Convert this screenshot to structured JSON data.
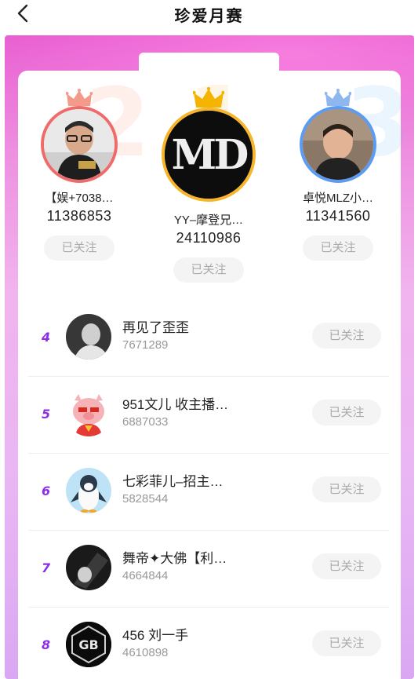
{
  "nav": {
    "title": "珍爱月赛",
    "back_icon": "chevron-left-icon"
  },
  "colors": {
    "rank_accent": "#8d2ee6",
    "header_gradient_top": "#e95fd2",
    "silver_ring": "#f06a6a",
    "gold_ring": "#f7b52c",
    "bronze_ring": "#5b9cf2"
  },
  "podium": [
    {
      "rank_bg": "2",
      "name": "【娱+7038…",
      "score": "11386853",
      "follow_label": "已关注",
      "crown": "crown-icon"
    },
    {
      "rank_bg": "1",
      "name": "YY–摩登兄…",
      "score": "24110986",
      "follow_label": "已关注",
      "crown": "crown-icon",
      "avatar_text": "MD"
    },
    {
      "rank_bg": "3",
      "name": "卓悦MLZ小…",
      "score": "11341560",
      "follow_label": "已关注",
      "crown": "crown-icon"
    }
  ],
  "list": [
    {
      "rank": "4",
      "name": "再见了歪歪",
      "score": "7671289",
      "follow_label": "已关注"
    },
    {
      "rank": "5",
      "name": "951文儿 收主播…",
      "score": "6887033",
      "follow_label": "已关注"
    },
    {
      "rank": "6",
      "name": "七彩菲儿–招主…",
      "score": "5828544",
      "follow_label": "已关注"
    },
    {
      "rank": "7",
      "name": "舞帝✦大佛【利…",
      "score": "4664844",
      "follow_label": "已关注"
    },
    {
      "rank": "8",
      "name": "456 刘一手",
      "score": "4610898",
      "follow_label": "已关注",
      "avatar_text": "GB"
    }
  ]
}
